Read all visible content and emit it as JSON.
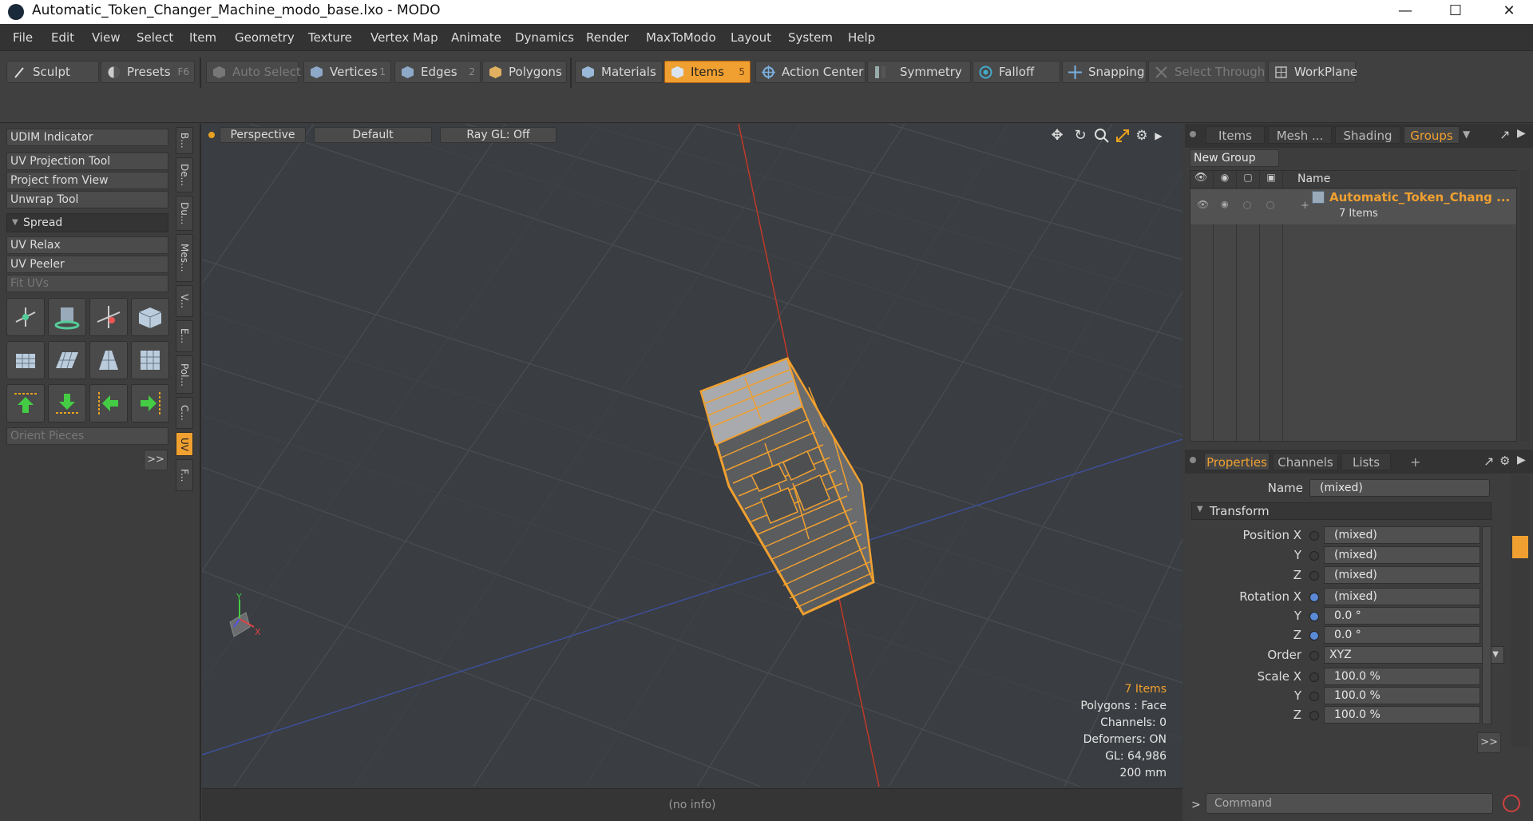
{
  "window": {
    "title": "Automatic_Token_Changer_Machine_modo_base.lxo - MODO"
  },
  "menu": [
    "File",
    "Edit",
    "View",
    "Select",
    "Item",
    "Geometry",
    "Texture",
    "Vertex Map",
    "Animate",
    "Dynamics",
    "Render",
    "MaxToModo",
    "Layout",
    "System",
    "Help"
  ],
  "toolbar": {
    "sculpt": "Sculpt",
    "presets": "Presets",
    "presets_key": "F6",
    "auto_select": "Auto Select",
    "vertices": "Vertices",
    "vertices_key": "1",
    "edges": "Edges",
    "edges_key": "2",
    "polygons": "Polygons",
    "materials": "Materials",
    "items": "Items",
    "items_key": "5",
    "action_center": "Action Center",
    "symmetry": "Symmetry",
    "falloff": "Falloff",
    "snapping": "Snapping",
    "select_through": "Select Through",
    "workplane": "WorkPlane"
  },
  "left_panel": {
    "udim": "UDIM Indicator",
    "uv_projection": "UV Projection Tool",
    "project_from_view": "Project from View",
    "unwrap": "Unwrap Tool",
    "spread": "Spread",
    "uv_relax": "UV Relax",
    "uv_peeler": "UV Peeler",
    "fit_uvs": "Fit UVs",
    "orient_pieces": "Orient Pieces",
    "more": ">>",
    "side_tabs": [
      "B...",
      "De...",
      "Du...",
      "Mes...",
      "V...",
      "E...",
      "Pol...",
      "C...",
      "UV",
      "F..."
    ]
  },
  "viewport": {
    "view": "Perspective",
    "shading": "Default",
    "raygl": "Ray GL: Off",
    "stats": {
      "items": "7 Items",
      "polygons": "Polygons : Face",
      "channels": "Channels: 0",
      "deformers": "Deformers: ON",
      "gl": "GL: 64,986",
      "scale": "200 mm"
    }
  },
  "status": {
    "info": "(no info)"
  },
  "right_panel": {
    "tabs_top": [
      "Items",
      "Mesh ...",
      "Shading",
      "Groups"
    ],
    "new_group": "New Group",
    "col_name": "Name",
    "group_name": "Automatic_Token_Chang ...",
    "group_count": "7 Items",
    "tabs_bottom": [
      "Properties",
      "Channels",
      "Lists",
      "+"
    ],
    "props": {
      "name_label": "Name",
      "name_value": "(mixed)",
      "transform": "Transform",
      "pos_label": "Position X",
      "pos": [
        "(mixed)",
        "(mixed)",
        "(mixed)"
      ],
      "rot_label": "Rotation X",
      "rot": [
        "(mixed)",
        "0.0 °",
        "0.0 °"
      ],
      "order_label": "Order",
      "order": "XYZ",
      "scale_label": "Scale X",
      "scale": [
        "100.0 %",
        "100.0 %",
        "100.0 %"
      ],
      "y": "Y",
      "z": "Z",
      "more": ">>"
    },
    "command_placeholder": "Command",
    "command_prompt": ">"
  },
  "colors": {
    "accent": "#f0a030",
    "x_axis": "#c03a2a",
    "z_axis": "#3e4f9a",
    "grid": "#4a4d52"
  }
}
